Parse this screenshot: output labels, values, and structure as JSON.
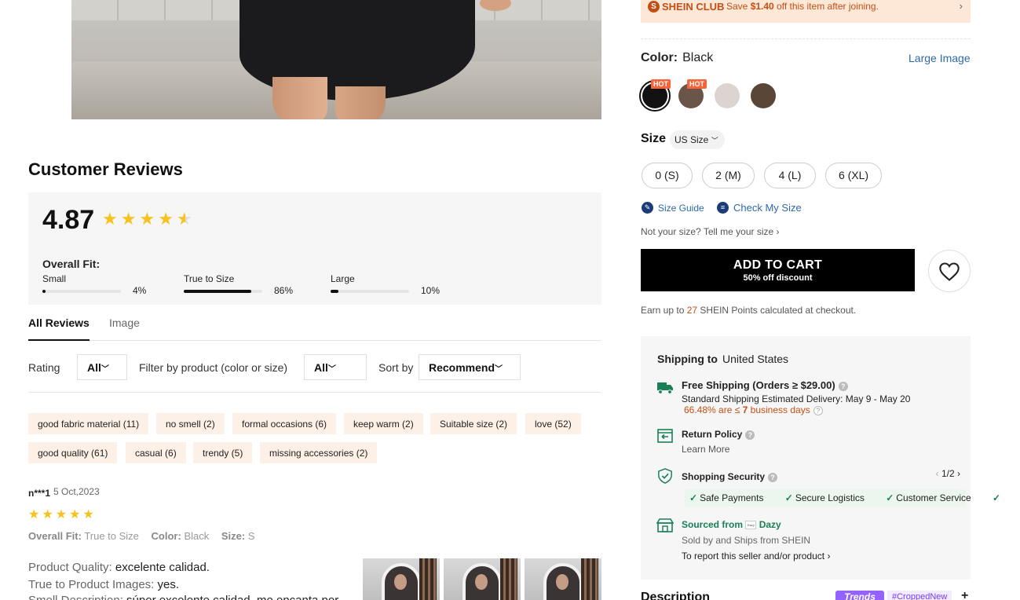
{
  "reviews": {
    "title": "Customer Reviews",
    "rating": "4.87",
    "overall_fit_label": "Overall Fit:",
    "fit": [
      {
        "label": "Small",
        "pct": "4%",
        "value": 4
      },
      {
        "label": "True to Size",
        "pct": "86%",
        "value": 86
      },
      {
        "label": "Large",
        "pct": "10%",
        "value": 10
      }
    ],
    "tabs": [
      "All Reviews",
      "Image"
    ],
    "filters": {
      "rating_label": "Rating",
      "rating_value": "All",
      "product_label": "Filter by product  (color or size)",
      "product_value": "All",
      "sort_label": "Sort by",
      "sort_value": "Recommend"
    },
    "tags": [
      "good fabric material (11)",
      "no smell (2)",
      "formal occasions (6)",
      "keep warm (2)",
      "Suitable size (2)",
      "love (52)",
      "good quality (61)",
      "casual (6)",
      "trendy (5)",
      "missing accessories (2)"
    ],
    "review": {
      "user": "n***1",
      "date": "5 Oct,2023",
      "stars": 5,
      "fit_key": "Overall Fit:",
      "fit_val": "True to Size",
      "color_key": "Color:",
      "color_val": "Black",
      "size_key": "Size:",
      "size_val": "S",
      "quality_key": "Product Quality:",
      "quality_val": "excelente calidad.",
      "images_key": "True to Product Images:",
      "images_val": "yes.",
      "smell_key": "Smell Description:",
      "smell_val": "súper excelente calidad, me encanta por"
    }
  },
  "club": {
    "logo": "S",
    "name": "SHEIN CLUB",
    "msg_pre": "Save ",
    "msg_amount": "$1.40",
    "msg_post": " off this item after joining."
  },
  "color": {
    "label": "Color:",
    "value": "Black",
    "large_image": "Large Image",
    "hot_badge": "HOT",
    "swatches": [
      "#121212",
      "#6b5449",
      "#dcd4d0",
      "#5a4636"
    ]
  },
  "size": {
    "label": "Size",
    "unit": "US Size",
    "options": [
      "0 (S)",
      "2 (M)",
      "4 (L)",
      "6 (XL)"
    ],
    "size_guide": "Size Guide",
    "check_my_size": "Check My Size",
    "not_your_size": "Not your size? Tell me your size"
  },
  "cart": {
    "label": "ADD TO CART",
    "discount": "50% off discount",
    "points_pre": "Earn up to ",
    "points_num": "27",
    "points_post": " SHEIN Points calculated at checkout."
  },
  "shipping": {
    "label": "Shipping to",
    "country": "United States",
    "free_shipping": "Free Shipping (Orders ≥ $29.00)",
    "standard": "Standard Shipping Estimated Delivery: May 9 - May 20",
    "on_time_pct": "66.48% are ≤",
    "on_time_days": "7",
    "on_time_suffix": "business days",
    "return_policy": "Return Policy",
    "learn_more": "Learn More",
    "security": "Shopping Security",
    "pager": "1/2",
    "security_items": [
      "Safe Payments",
      "Secure Logistics",
      "Customer Service"
    ],
    "sourced_from": "Sourced from",
    "seller_brand": "Dazy",
    "seller_logo": "Dazy",
    "sold_by": "Sold by and Ships from SHEIN",
    "report": "To report this seller and/or product"
  },
  "description": {
    "title": "Description",
    "trends_badge": "Trends",
    "tag": "#CroppedNew",
    "plus": "+"
  }
}
